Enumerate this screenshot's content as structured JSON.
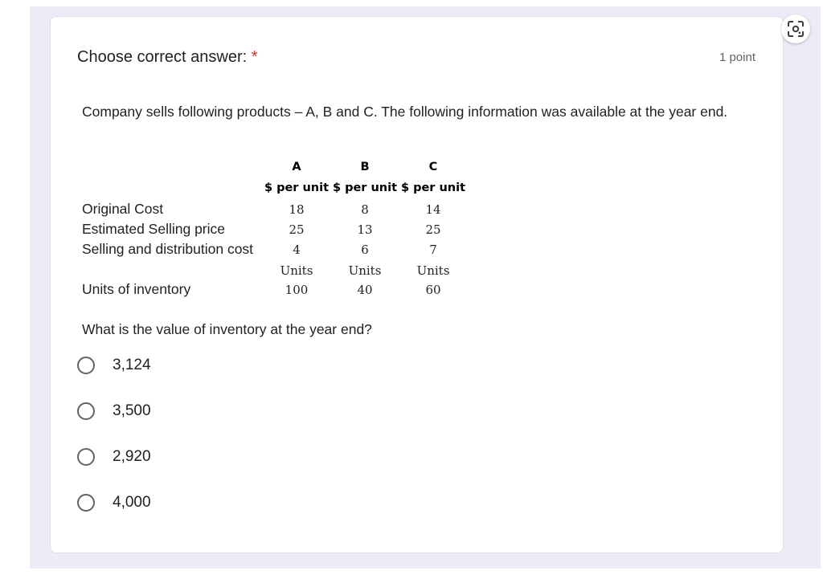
{
  "question": {
    "title": "Choose correct answer:",
    "required_mark": "*",
    "points": "1 point"
  },
  "image_content": {
    "intro": "Company sells following products – A, B and C. The following information was available at the year end.",
    "table": {
      "product_headers": [
        "A",
        "B",
        "C"
      ],
      "unit_headers": [
        "$ per unit",
        "$ per unit",
        "$ per unit"
      ],
      "rows": [
        {
          "label": "Original Cost",
          "values": [
            "18",
            "8",
            "14"
          ]
        },
        {
          "label": "Estimated Selling price",
          "values": [
            "25",
            "13",
            "25"
          ]
        },
        {
          "label": "Selling and distribution cost",
          "values": [
            "4",
            "6",
            "7"
          ]
        }
      ],
      "units_headers": [
        "Units",
        "Units",
        "Units"
      ],
      "inventory_row": {
        "label": "Units of inventory",
        "values": [
          "100",
          "40",
          "60"
        ]
      }
    },
    "question_text": "What is the value of inventory at the year end?"
  },
  "options": [
    "3,124",
    "3,500",
    "2,920",
    "4,000"
  ],
  "icons": {
    "lens_button": "google-lens-icon",
    "option_radio": "radio-unchecked-icon"
  },
  "colors": {
    "required": "#d93025",
    "page_background": "#eeeaf7",
    "card": "#ffffff"
  }
}
